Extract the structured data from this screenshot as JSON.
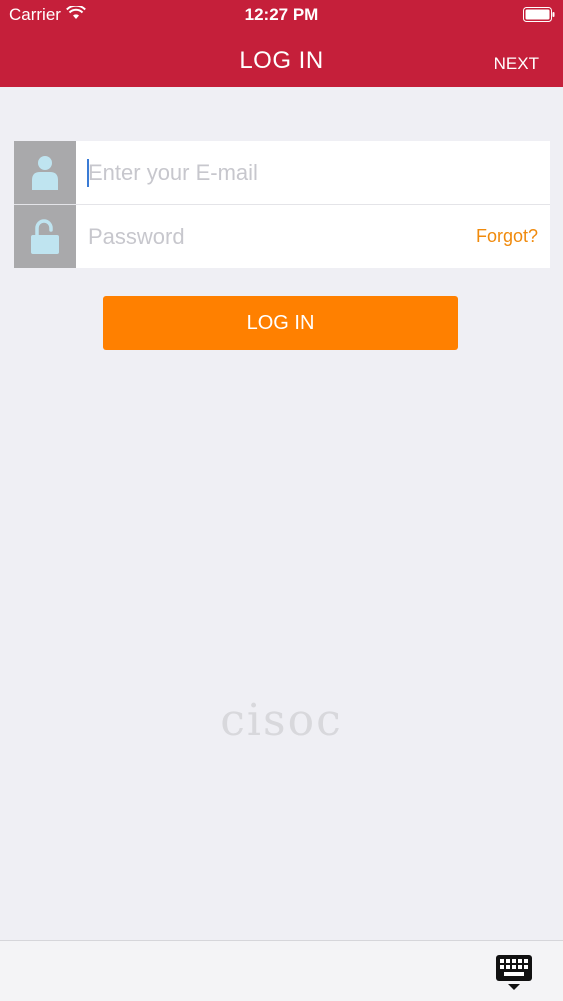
{
  "status_bar": {
    "carrier": "Carrier",
    "time": "12:27 PM"
  },
  "nav": {
    "title": "LOG IN",
    "next_label": "NEXT"
  },
  "form": {
    "email": {
      "placeholder": "Enter your E-mail",
      "icon": "user-icon"
    },
    "password": {
      "placeholder": "Password",
      "icon": "unlock-icon",
      "forgot_label": "Forgot?"
    }
  },
  "login_button": {
    "label": "LOG IN"
  },
  "logo": {
    "text": "cisoc"
  },
  "colors": {
    "header": "#c51f3a",
    "primary_button": "#ff8000",
    "forgot_link": "#f08a0c",
    "icon_box": "#a9a9ab",
    "icon_fill": "#bfe4f0",
    "background": "#efeff4"
  },
  "keyboard_toggle": {
    "icon": "keyboard-icon"
  }
}
